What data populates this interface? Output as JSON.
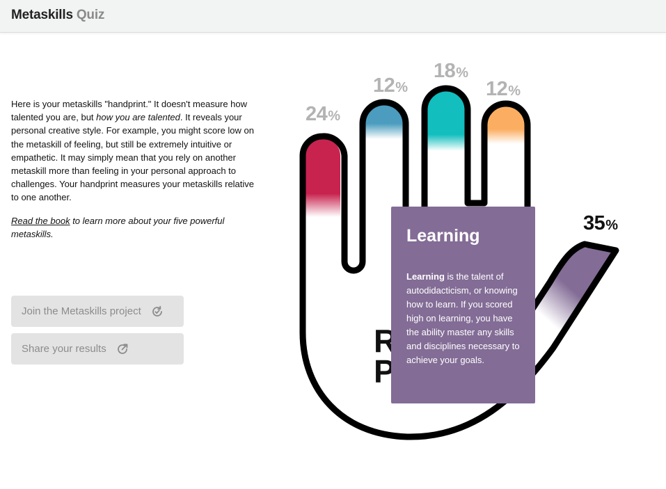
{
  "header": {
    "brand": "Metaskills",
    "section": "Quiz"
  },
  "intro": {
    "p1_a": "Here is your metaskills \"handprint.\" It doesn't measure how talented you are, but ",
    "p1_em": "how you are talented",
    "p1_b": ". It reveals your personal creative style. For example, you might score low on the metaskill of feeling, but still be extremely intuitive or empathetic. It may simply mean that you rely on another metaskill more than feeling in your personal approach to challenges. Your handprint measures your metaskills relative to one another.",
    "link": "Read the book",
    "p2_rest": " to learn more about your five powerful metaskills."
  },
  "buttons": {
    "join": "Join the Metaskills project",
    "share": "Share your results"
  },
  "handprint": {
    "fingers": [
      {
        "score": "24",
        "color": "#c8234f"
      },
      {
        "score": "12",
        "color": "#4b9cbe"
      },
      {
        "score": "18",
        "color": "#12bebe"
      },
      {
        "score": "12",
        "color": "#fbae62"
      },
      {
        "score": "35",
        "color": "#836c96"
      }
    ],
    "unit": "%",
    "center_lines": [
      "R",
      "P"
    ]
  },
  "tooltip": {
    "title": "Learning",
    "term": "Learning",
    "body": " is the talent of autodidacticism, or knowing how to learn. If you scored high on learning, you have the ability master any skills and disciplines necessary to achieve your goals."
  }
}
